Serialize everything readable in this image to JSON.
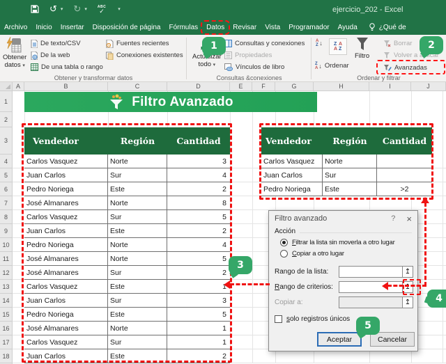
{
  "colors": {
    "excel_green": "#217346",
    "banner_green": "#27a45b",
    "table_header_green": "#1e6b3c",
    "badge_green": "#35a768",
    "annotation_red": "#f01212",
    "ok_button_border_blue": "#2b6cb5"
  },
  "icons": {
    "caret_down": "▾",
    "undo": "↺",
    "redo": "↻",
    "check": "✓",
    "spell_abc": "ABC",
    "collapse_up": "↥",
    "help_glyph": "?",
    "close_glyph": "×"
  },
  "titlebar": {
    "title": "ejercicio_202 - Excel"
  },
  "tabbar": {
    "tabs": [
      "Archivo",
      "Inicio",
      "Insertar",
      "Disposición de página",
      "Fórmulas",
      "Datos",
      "Revisar",
      "Vista",
      "Programador",
      "Ayuda"
    ],
    "search_label": "¿Qué de"
  },
  "ribbon": {
    "groups": [
      {
        "label": "Obtener y transformar datos",
        "big_button": [
          "Obtener",
          "datos"
        ],
        "items": [
          "De texto/CSV",
          "De la web",
          "De una tabla o rango",
          "Fuentes recientes",
          "Conexiones existentes"
        ]
      },
      {
        "label": "Consultas &conexiones",
        "big_button": [
          "Actualizar",
          "todo"
        ],
        "items": [
          "Consultas y conexiones",
          "Propiedades",
          "Vínculos de libro"
        ]
      },
      {
        "label": "Ordenar y filtrar",
        "items": [
          "Ordenar",
          "Filtro",
          "Borrar",
          "Volver a aplicar",
          "Avanzadas"
        ]
      }
    ]
  },
  "sheet": {
    "column_letters": [
      "A",
      "B",
      "C",
      "D",
      "E",
      "F",
      "G",
      "H",
      "I",
      "J"
    ],
    "row_numbers": [
      "1",
      "2",
      "3",
      "4",
      "5",
      "6",
      "7",
      "8",
      "9",
      "10",
      "11",
      "12",
      "13",
      "14",
      "15",
      "16",
      "17",
      "18"
    ],
    "banner": {
      "title": "Filtro Avanzado"
    },
    "main_table": {
      "headers": [
        "Vendedor",
        "Región",
        "Cantidad"
      ],
      "rows": [
        [
          "Carlos Vasquez",
          "Norte",
          "3"
        ],
        [
          "Juan Carlos",
          "Sur",
          "4"
        ],
        [
          "Pedro Noriega",
          "Este",
          "2"
        ],
        [
          "José Almanares",
          "Norte",
          "8"
        ],
        [
          "Carlos Vasquez",
          "Sur",
          "5"
        ],
        [
          "Juan Carlos",
          "Este",
          "2"
        ],
        [
          "Pedro Noriega",
          "Norte",
          "4"
        ],
        [
          "José Almanares",
          "Norte",
          "5"
        ],
        [
          "José Almanares",
          "Sur",
          "2"
        ],
        [
          "Carlos Vasquez",
          "Este",
          "1"
        ],
        [
          "Juan Carlos",
          "Sur",
          "3"
        ],
        [
          "Pedro Noriega",
          "Este",
          "5"
        ],
        [
          "José Almanares",
          "Norte",
          "1"
        ],
        [
          "Carlos Vasquez",
          "Sur",
          "1"
        ],
        [
          "Juan Carlos",
          "Este",
          "2"
        ]
      ]
    },
    "criteria_table": {
      "headers": [
        "Vendedor",
        "Región",
        "Cantidad"
      ],
      "rows": [
        [
          "Carlos Vasquez",
          "Norte",
          ""
        ],
        [
          "Juan Carlos",
          "Sur",
          ""
        ],
        [
          "Pedro Noriega",
          "Este",
          ">2"
        ]
      ]
    }
  },
  "dialog": {
    "title": "Filtro avanzado",
    "section_label": "Acción",
    "radio_filter": {
      "accel": "F",
      "rest": "iltrar la lista sin moverla a otro lugar",
      "selected": true
    },
    "radio_copy": {
      "accel": "C",
      "rest": "opiar a otro lugar",
      "selected": false
    },
    "field_list": {
      "pre": "Ran",
      "accel": "g",
      "rest": "o de la lista:",
      "value": ""
    },
    "field_criteria": {
      "accel": "R",
      "rest": "ango de criterios:",
      "value": ""
    },
    "field_copy": {
      "label": "Copiar a:",
      "value": ""
    },
    "checkbox": {
      "accel": "s",
      "rest": "olo registros únicos",
      "checked": false
    },
    "ok_label": "Aceptar",
    "cancel_label": "Cancelar"
  },
  "badges": [
    "1",
    "2",
    "3",
    "4",
    "5"
  ]
}
